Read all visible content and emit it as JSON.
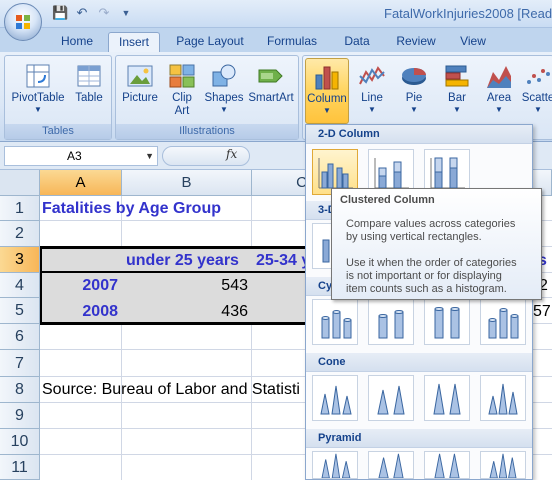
{
  "window": {
    "title": "FatalWorkInjuries2008  [Read"
  },
  "qat": {
    "save_icon": "save-icon",
    "undo_icon": "undo-icon",
    "redo_icon": "redo-icon",
    "customize_icon": "customize-qat-icon"
  },
  "tabs": [
    {
      "label": "Home"
    },
    {
      "label": "Insert"
    },
    {
      "label": "Page Layout"
    },
    {
      "label": "Formulas"
    },
    {
      "label": "Data"
    },
    {
      "label": "Review"
    },
    {
      "label": "View"
    }
  ],
  "ribbon": {
    "groups": {
      "tables": "Tables",
      "illustrations": "Illustrations"
    },
    "buttons": {
      "pivottable": "PivotTable",
      "table": "Table",
      "picture": "Picture",
      "clipart_1": "Clip",
      "clipart_2": "Art",
      "shapes": "Shapes",
      "smartart": "SmartArt",
      "column": "Column",
      "line": "Line",
      "pie": "Pie",
      "bar": "Bar",
      "area": "Area",
      "scatter": "Scatte"
    },
    "accent_active": "#ffd560"
  },
  "formula_bar": {
    "name_box": "A3",
    "fx": "fx"
  },
  "columns": [
    "A",
    "B",
    "C",
    "E"
  ],
  "rows": [
    "1",
    "2",
    "3",
    "4",
    "5",
    "6",
    "7",
    "8",
    "9",
    "10",
    "11"
  ],
  "cells": {
    "a1": "Fatalities by Age Group",
    "b3": "under 25 years",
    "c3": "25-34 y",
    "a4": "2007",
    "b4": "543",
    "a5": "2008",
    "b5": "436",
    "e3_partial": "s",
    "e4_partial": "2",
    "e5_partial": "57",
    "a8": "Source:  Bureau of Labor and Statisti"
  },
  "gallery": {
    "sections": {
      "col2d": "2-D Column",
      "col3d": "3-D",
      "cylinder": "Cy",
      "cone": "Cone",
      "pyramid": "Pyramid"
    }
  },
  "tooltip": {
    "title": "Clustered Column",
    "line1": "Compare values across categories",
    "line2": "by using vertical rectangles.",
    "line3": "Use it when the order of categories",
    "line4": "is not important or for displaying",
    "line5": "item counts such as a histogram."
  }
}
